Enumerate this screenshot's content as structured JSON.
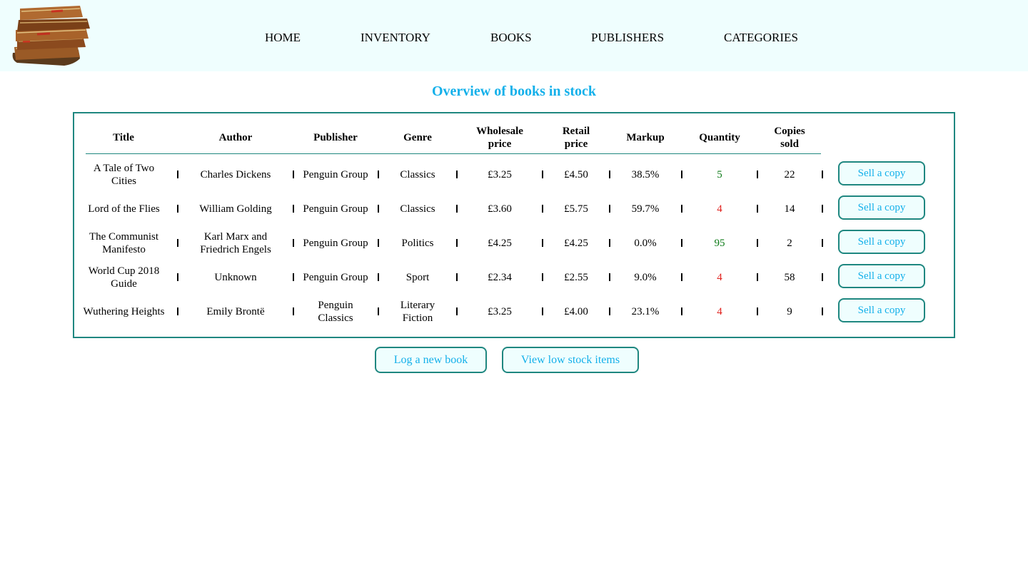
{
  "nav": {
    "links": [
      "HOME",
      "INVENTORY",
      "BOOKS",
      "PUBLISHERS",
      "CATEGORIES"
    ]
  },
  "page": {
    "title": "Overview of books in stock"
  },
  "table": {
    "headers": [
      "Title",
      "Author",
      "Publisher",
      "Genre",
      "Wholesale price",
      "Retail price",
      "Markup",
      "Quantity",
      "Copies sold"
    ],
    "separator": "|",
    "sell_label": "Sell a copy",
    "rows": [
      {
        "title": "A Tale of Two Cities",
        "author": "Charles Dickens",
        "publisher": "Penguin Group",
        "genre": "Classics",
        "wholesale": "£3.25",
        "retail": "£4.50",
        "markup": "38.5%",
        "quantity": "5",
        "quantity_status": "ok",
        "sold": "22"
      },
      {
        "title": "Lord of the Flies",
        "author": "William Golding",
        "publisher": "Penguin Group",
        "genre": "Classics",
        "wholesale": "£3.60",
        "retail": "£5.75",
        "markup": "59.7%",
        "quantity": "4",
        "quantity_status": "low",
        "sold": "14"
      },
      {
        "title": "The Communist Manifesto",
        "author": "Karl Marx and Friedrich Engels",
        "publisher": "Penguin Group",
        "genre": "Politics",
        "wholesale": "£4.25",
        "retail": "£4.25",
        "markup": "0.0%",
        "quantity": "95",
        "quantity_status": "ok",
        "sold": "2"
      },
      {
        "title": "World Cup 2018 Guide",
        "author": "Unknown",
        "publisher": "Penguin Group",
        "genre": "Sport",
        "wholesale": "£2.34",
        "retail": "£2.55",
        "markup": "9.0%",
        "quantity": "4",
        "quantity_status": "low",
        "sold": "58"
      },
      {
        "title": "Wuthering Heights",
        "author": "Emily Brontë",
        "publisher": "Penguin Classics",
        "genre": "Literary Fiction",
        "wholesale": "£3.25",
        "retail": "£4.00",
        "markup": "23.1%",
        "quantity": "4",
        "quantity_status": "low",
        "sold": "9"
      }
    ]
  },
  "actions": {
    "log_new_book": "Log a new book",
    "view_low_stock": "View low stock items"
  },
  "colors": {
    "header_bg": "#effefe",
    "accent": "#13b0ea",
    "border": "#1f8780",
    "qty_ok": "#0c7a17",
    "qty_low": "#e0201c"
  },
  "icons": {
    "logo": "stacked-old-books-logo"
  }
}
